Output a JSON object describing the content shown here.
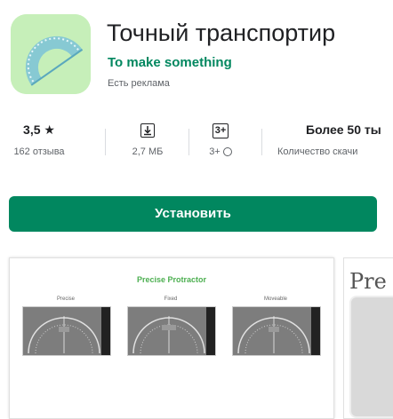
{
  "app": {
    "title": "Точный транспортир",
    "developer": "To make something",
    "ads_notice": "Есть реклама",
    "icon": "protractor-app-icon"
  },
  "stats": {
    "rating_value": "3,5",
    "rating_star": "★",
    "reviews": "162 отзыва",
    "download_icon": "download-icon",
    "size": "2,7 МБ",
    "age_badge": "3+",
    "age_label": "3+",
    "age_info_icon": "info-icon",
    "downloads_value": "Более 50 ты",
    "downloads_label": "Количество скачи"
  },
  "install": {
    "label": "Установить"
  },
  "screenshots": {
    "first": {
      "title": "Precise Protractor",
      "phone_labels": [
        "Precise",
        "Fixed",
        "Moveable"
      ]
    },
    "second": {
      "title_fragment": "Pre"
    }
  },
  "colors": {
    "accent": "#01875f",
    "icon_bg": "#c6efb9",
    "text_secondary": "#5f6368"
  }
}
